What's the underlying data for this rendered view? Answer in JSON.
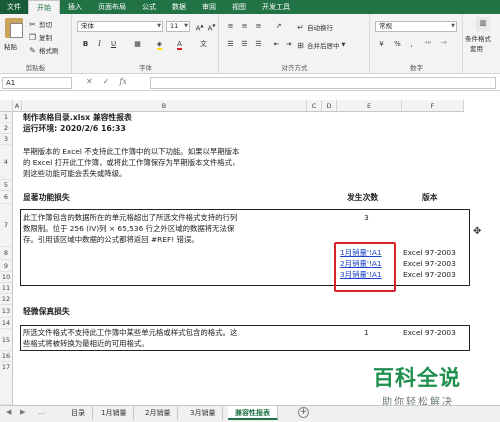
{
  "ribbon_tabs": [
    "文件",
    "开始",
    "插入",
    "页面布局",
    "公式",
    "数据",
    "审阅",
    "视图",
    "开发工具"
  ],
  "active_tab": "开始",
  "clipboard": {
    "cut": "剪切",
    "copy": "复制",
    "format_painter": "格式刷",
    "paste": "粘贴",
    "group": "剪贴板"
  },
  "font": {
    "name": "宋体",
    "size": "11",
    "group": "字体"
  },
  "alignment": {
    "wrap": "自动换行",
    "merge": "合并后居中",
    "group": "对齐方式"
  },
  "number": {
    "format": "常规",
    "group": "数字"
  },
  "styles": {
    "conditional": "条件格式",
    "table": "套用"
  },
  "name_box": "A1",
  "fx": "fx",
  "columns": [
    "A",
    "B",
    "C",
    "D",
    "E",
    "F"
  ],
  "rows": [
    "1",
    "2",
    "3",
    "4",
    "5",
    "6",
    "7",
    "8",
    "9",
    "10",
    "11",
    "12",
    "13",
    "14",
    "15",
    "16",
    "17"
  ],
  "sheet": {
    "r1": "制作表格目录.xlsx 兼容性报表",
    "r2": "运行环境: 2020/2/6 16:33",
    "r4a": "早期版本的 Excel 不支持此工作簿中的以下功能。如果以早期版本",
    "r4b": "的 Excel 打开此工作簿，或将此工作簿保存为早期版本文件格式，",
    "r4c": "则这些功能可能会丢失或降级。",
    "r6_title": "显著功能损失",
    "r6_count_hdr": "发生次数",
    "r6_version_hdr": "版本",
    "r7a": "此工作簿包含的数据所在的单元格超出了所选文件格式支持的行列",
    "r7b": "数限制。位于 256 (IV)列 × 65,536 行之外区域的数据将无法保",
    "r7c": "存。引用该区域中数据的公式都将返回 #REF! 错误。",
    "r7_count": "3",
    "links": [
      "1月销量'!A1",
      "2月销量'!A1",
      "3月销量'!A1"
    ],
    "versions": [
      "Excel 97-2003",
      "Excel 97-2003",
      "Excel 97-2003"
    ],
    "r13_title": "轻微保真损失",
    "r15a": "所选文件格式不支持此工作簿中某些单元格或样式包含的格式。这",
    "r15b": "些格式将被转换为最相近的可用格式。",
    "r15_count": "1",
    "r15_version": "Excel 97-2003"
  },
  "sheet_tabs": [
    "目录",
    "1月销量",
    "2月销量",
    "3月销量",
    "兼容性报表"
  ],
  "active_sheet": "兼容性报表",
  "watermark": {
    "title": "百科全说",
    "subtitle": "助你轻松解决"
  },
  "colors": {
    "excel_green": "#217346",
    "highlight_red": "#d9232b",
    "link_blue": "#1f46c8"
  }
}
